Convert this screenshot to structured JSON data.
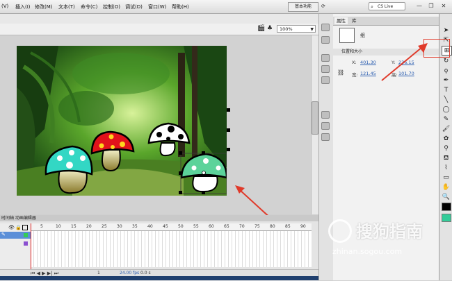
{
  "menubar": {
    "items": [
      "(V)",
      "插入(I)",
      "修改(M)",
      "文本(T)",
      "命令(C)",
      "控制(O)",
      "调试(D)",
      "窗口(W)",
      "帮助(H)"
    ],
    "workspace": "基本功能",
    "search_label": "CS Live",
    "window_controls": {
      "minimize": "—",
      "restore": "❐",
      "close": "✕"
    }
  },
  "editbar": {
    "zoom": "100%"
  },
  "timeline": {
    "title": "时间轴 动画编辑器",
    "ticks": [
      "5",
      "10",
      "15",
      "20",
      "25",
      "30",
      "35",
      "40",
      "45",
      "50",
      "55",
      "60",
      "65",
      "70",
      "75",
      "80",
      "85",
      "90"
    ],
    "status": {
      "frame": "1",
      "fps": "24.00 fps",
      "time": "0.0 s"
    }
  },
  "properties": {
    "tabs": [
      "属性",
      "库"
    ],
    "object_type": "组",
    "section": "位置和大小",
    "x_label": "X:",
    "x_value": "401.30",
    "y_label": "Y:",
    "y_value": "236.15",
    "w_label": "宽:",
    "w_value": "121.45",
    "h_label": "高:",
    "h_value": "101.70"
  },
  "watermark": {
    "text": "搜狗指南",
    "url": "zhinan.sogou.com"
  },
  "colors": {
    "accent_red": "#e03a2a",
    "link_blue": "#2a5db0",
    "stroke": "#000000",
    "fill": "#33cc99"
  },
  "icons": [
    "selection-tool-icon",
    "subselection-tool-icon",
    "free-transform-tool-icon",
    "lasso-tool-icon",
    "pen-tool-icon",
    "text-tool-icon",
    "line-tool-icon",
    "rectangle-tool-icon",
    "pencil-tool-icon",
    "brush-tool-icon",
    "paint-bucket-icon",
    "eyedropper-icon",
    "eraser-icon",
    "hand-tool-icon",
    "zoom-tool-icon"
  ]
}
